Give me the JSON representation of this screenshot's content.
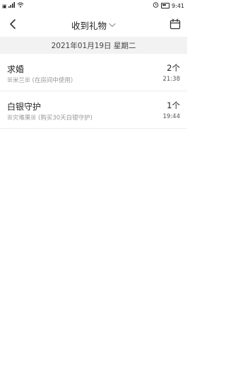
{
  "status_bar": {
    "icons": [
      "sim-icon",
      "signal-icon",
      "wifi-icon"
    ],
    "right_icons": [
      "alarm-icon",
      "battery-icon"
    ],
    "time": "9:41"
  },
  "header": {
    "title": "收到礼物",
    "back_icon": "chevron-left-icon",
    "dropdown_icon": "chevron-down-icon",
    "calendar_icon": "calendar-icon"
  },
  "date_header": "2021年01月19日 星期二",
  "gifts": [
    {
      "name": "求婚",
      "sender": "米兰",
      "note": "(在房间中使用)",
      "count": "2个",
      "time": "21:38"
    },
    {
      "name": "白银守护",
      "sender": "灾难果",
      "note": "(购买30天白银守护)",
      "count": "1个",
      "time": "19:44"
    }
  ]
}
